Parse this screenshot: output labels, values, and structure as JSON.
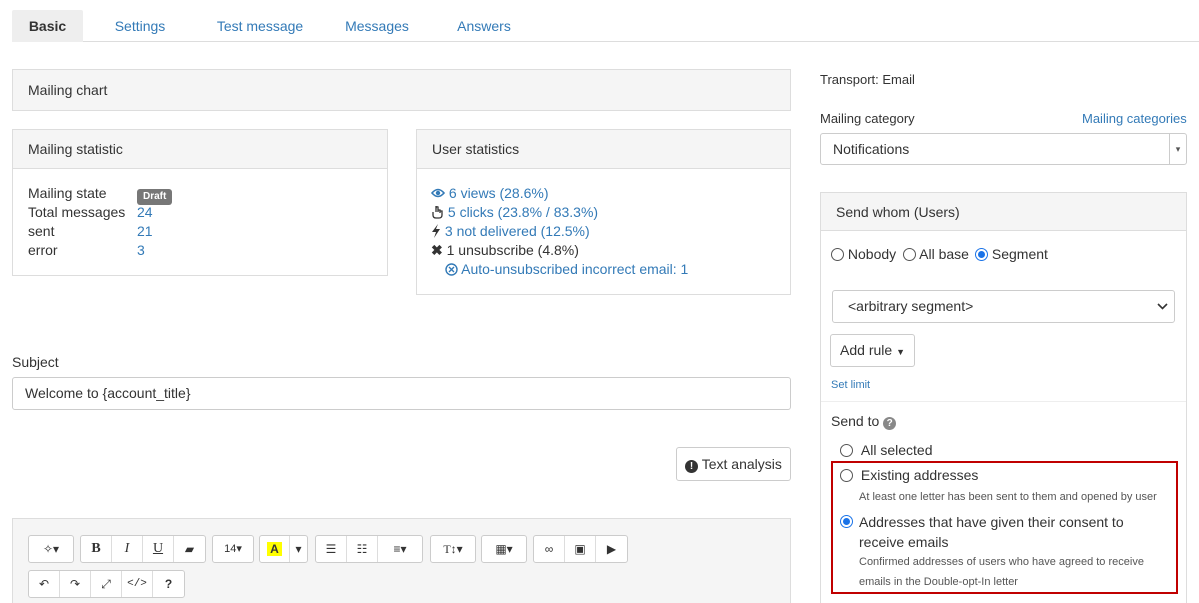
{
  "tabs": [
    "Basic",
    "Settings",
    "Test message",
    "Messages",
    "Answers"
  ],
  "mailing_chart": {
    "title": "Mailing chart"
  },
  "mailing_statistic": {
    "title": "Mailing statistic",
    "state_label": "Mailing state",
    "state_badge": "Draft",
    "total_label": "Total messages",
    "total_value": "24",
    "sent_label": "sent",
    "sent_value": "21",
    "error_label": "error",
    "error_value": "3"
  },
  "user_statistics": {
    "title": "User statistics",
    "views": "6 views (28.6%)",
    "clicks": "5 clicks (23.8% / 83.3%)",
    "not_delivered": "3 not delivered (12.5%)",
    "unsubscribe": "1 unsubscribe (4.8%)",
    "auto_unsub": "Auto-unsubscribed incorrect email: 1"
  },
  "subject": {
    "label": "Subject",
    "value": "Welcome to {account_title}"
  },
  "text_analysis": "Text analysis",
  "toolbar": {
    "font_size": "14",
    "font_size_icon": "T↕"
  },
  "right": {
    "transport": "Transport: Email",
    "category_label": "Mailing category",
    "category_link": "Mailing categories",
    "category_value": "Notifications",
    "send_whom_title": "Send whom (Users)",
    "radio_nobody": "Nobody",
    "radio_all_base": "All base",
    "radio_segment": "Segment",
    "segment_value": "<arbitrary segment>",
    "add_rule": "Add rule",
    "set_limit": "Set limit",
    "send_to_label": "Send to",
    "opt_all_selected": "All selected",
    "opt_existing": "Existing addresses",
    "opt_existing_desc": "At least one letter has been sent to them and opened by user",
    "opt_consent": "Addresses that have given their consent to receive emails",
    "opt_consent_desc": "Confirmed addresses of users who have agreed to receive emails in the Double-opt-In letter"
  },
  "colors": {
    "link": "#337ab7",
    "highlight_border": "#c00000",
    "radio_on": "#1a73e8"
  }
}
